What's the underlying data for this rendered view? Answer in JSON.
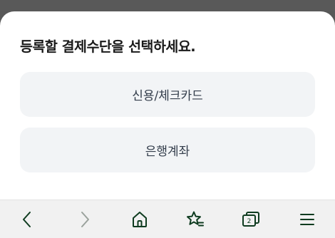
{
  "sheet": {
    "title": "등록할 결제수단을 선택하세요.",
    "options": [
      {
        "label": "신용/체크카드"
      },
      {
        "label": "은행계좌"
      }
    ]
  },
  "toolbar": {
    "tab_count": "2",
    "icons": [
      "back-arrow-icon",
      "forward-arrow-icon",
      "home-icon",
      "bookmark-star-icon",
      "tabs-icon",
      "menu-icon"
    ],
    "icon_color": "#0e3b1f",
    "disabled_color": "#9aa29c"
  }
}
